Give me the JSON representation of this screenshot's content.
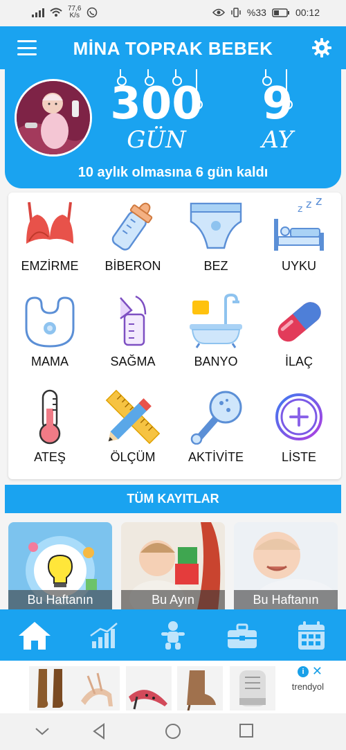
{
  "status_bar": {
    "net_speed_value": "77,6",
    "net_speed_unit": "K/s",
    "battery": "%33",
    "time": "00:12"
  },
  "app_bar": {
    "title": "MİNA TOPRAK  BEBEK",
    "menu_icon": "hamburger-menu-icon",
    "settings_icon": "gear-icon"
  },
  "header": {
    "days_value": "300",
    "days_label": "GÜN",
    "months_value": "9",
    "months_label": "AY",
    "remaining_text": "10 aylık olmasına 6 gün kaldı"
  },
  "activities": [
    {
      "label": "EMZİRME",
      "icon": "bra-icon"
    },
    {
      "label": "BİBERON",
      "icon": "baby-bottle-icon"
    },
    {
      "label": "BEZ",
      "icon": "diaper-icon"
    },
    {
      "label": "UYKU",
      "icon": "sleep-bed-icon"
    },
    {
      "label": "MAMA",
      "icon": "bib-icon"
    },
    {
      "label": "SAĞMA",
      "icon": "breast-pump-icon"
    },
    {
      "label": "BANYO",
      "icon": "bathtub-icon"
    },
    {
      "label": "İLAÇ",
      "icon": "pill-capsule-icon"
    },
    {
      "label": "ATEŞ",
      "icon": "thermometer-icon"
    },
    {
      "label": "ÖLÇÜM",
      "icon": "ruler-pencil-icon"
    },
    {
      "label": "AKTİVİTE",
      "icon": "rattle-icon"
    },
    {
      "label": "LİSTE",
      "icon": "plus-circle-icon"
    }
  ],
  "all_records_label": "TÜM KAYITLAR",
  "cards": [
    {
      "caption": "Bu Haftanın"
    },
    {
      "caption": "Bu Ayın"
    },
    {
      "caption": "Bu Haftanın"
    }
  ],
  "bottom_nav": [
    {
      "icon": "home-icon"
    },
    {
      "icon": "chart-icon"
    },
    {
      "icon": "baby-icon"
    },
    {
      "icon": "toolbox-icon"
    },
    {
      "icon": "calendar-icon"
    }
  ],
  "ad": {
    "brand": "trendyol",
    "info_icon": "info-icon",
    "close_icon": "close-icon"
  },
  "colors": {
    "primary": "#1aa3f0",
    "text": "#111111"
  }
}
